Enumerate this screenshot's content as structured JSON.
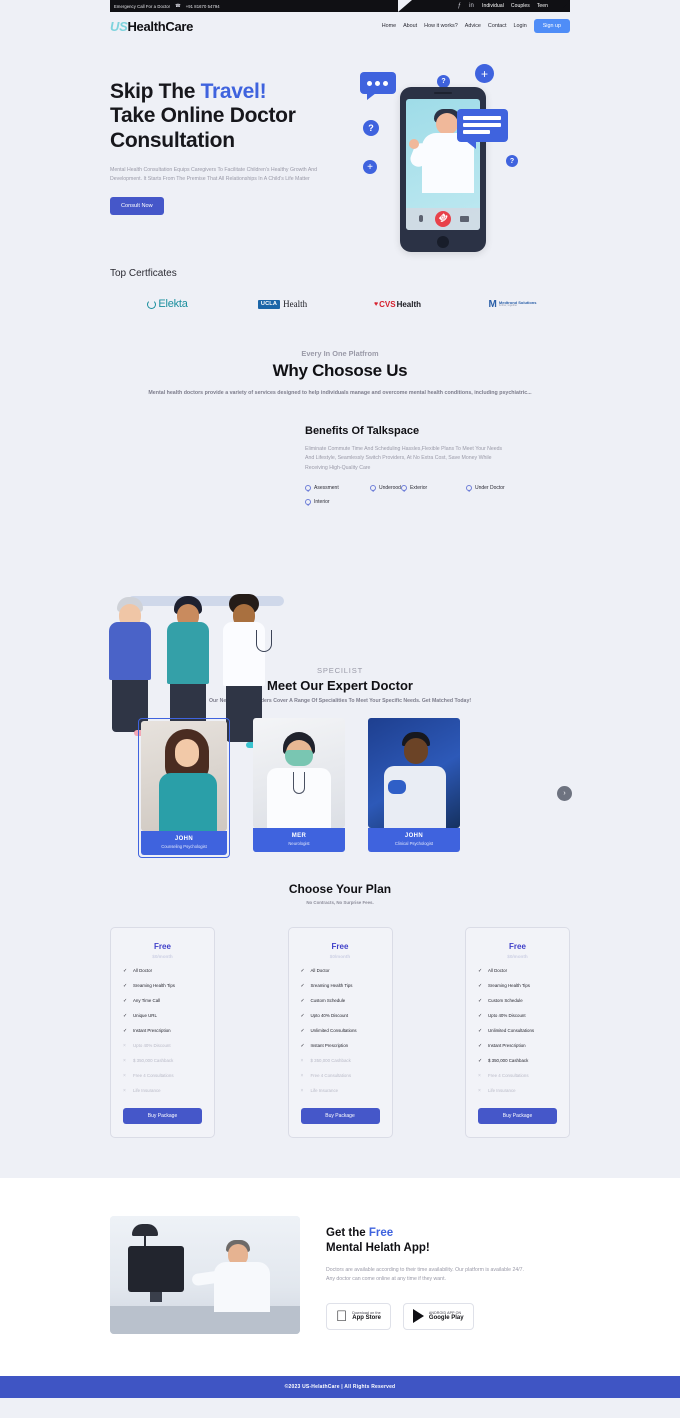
{
  "topbar": {
    "emergency_text": "Emergency Call For a Doctor",
    "phone_icon": "phone-icon",
    "phone": "+91 81670 54794",
    "social": [
      {
        "name": "facebook-icon",
        "glyph": "ƒ"
      },
      {
        "name": "linkedin-icon",
        "glyph": "in"
      }
    ],
    "links": [
      "Individual",
      "Couples",
      "Teen"
    ]
  },
  "nav": {
    "logo_us": "US",
    "logo_rest": "HealthCare",
    "links": [
      "Home",
      "About",
      "How it works?",
      "Advice",
      "Contact",
      "Login"
    ],
    "signup_label": "Sign up"
  },
  "hero": {
    "title_line1_a": "Skip The ",
    "title_line1_b": "Travel!",
    "title_line2": "Take Online Doctor",
    "title_line3": "Consultation",
    "paragraph": "Mental Health Consultation Equips Caregivers To Facilitate Children's Healthy Growth And Development. It Starts From The Premise That All Relationships In A Child's Life Matter",
    "cta_label": "Consult Now",
    "illustration": {
      "plus_glyph": "+",
      "question_glyph": "?"
    }
  },
  "certificates": {
    "title": "Top Certficates",
    "items": [
      {
        "name": "elekta-logo",
        "text": "Elekta"
      },
      {
        "name": "ucla-health-logo",
        "badge": "UCLA",
        "text": "Health"
      },
      {
        "name": "cvs-health-logo",
        "heart": "♥",
        "bold": "CVS",
        "text": "Health"
      },
      {
        "name": "medtronic-solutions-logo",
        "mark": "M",
        "text": "Medtrond Solutions",
        "sub": "further, together"
      }
    ]
  },
  "why": {
    "eyebrow": "Every In One Platfrom",
    "title": "Why Chosose Us",
    "subtitle": "Mental health doctors provide a variety of services designed to help individuals manage and overcome mental health conditions, including psychiatric..."
  },
  "benefits": {
    "title": "Benefits Of Talkspace",
    "paragraph": "Eliminate Commute Time And Scheduling Hassles,Flexible Plans To Meet Your Needs And Lifestyle, Seamlessly Switch Providers, At No Extra Cost, Save Money While Receiving High-Quality Care",
    "items": [
      "Asessment",
      "Underood",
      "Exterior",
      "Under Doctor",
      "Interior"
    ]
  },
  "specialist": {
    "eyebrow": "SPECILIST",
    "title": "Meet Our Expert Doctor",
    "subtitle": "Our Network of Providers Cover A Range Of Specialities To Meet Your Specific Needs. Get Matched Today!",
    "next_glyph": "›",
    "doctors": [
      {
        "name": "JOHN",
        "role": "Counseling Psychologist",
        "photo": "female-doctor-photo"
      },
      {
        "name": "MER",
        "role": "Neurologist",
        "photo": "masked-doctor-photo"
      },
      {
        "name": "JOHN",
        "role": "Clinical Psychologist",
        "photo": "lab-doctor-photo"
      }
    ]
  },
  "plans": {
    "title": "Choose Your Plan",
    "subtitle": "No Contracts, No Surprise Fees.",
    "buy_label": "Buy Package",
    "cards": [
      {
        "name": "Free",
        "price": "$0/month",
        "features": [
          {
            "label": "All Doctor",
            "included": true
          },
          {
            "label": "Sreaming Health Tips",
            "included": true
          },
          {
            "label": "Any Time Call",
            "included": true
          },
          {
            "label": "Unique URL",
            "included": true
          },
          {
            "label": "Instant Prescription",
            "included": true
          },
          {
            "label": "Upto 40% Discount",
            "included": false
          },
          {
            "label": "$ 350,000 Cashback",
            "included": false
          },
          {
            "label": "Free 4 Consultations",
            "included": false
          },
          {
            "label": "Life Insurance",
            "included": false
          }
        ]
      },
      {
        "name": "Free",
        "price": "$0/month",
        "features": [
          {
            "label": "All Doctor",
            "included": true
          },
          {
            "label": "Sreaming Health Tips",
            "included": true
          },
          {
            "label": "Custom Schedule",
            "included": true
          },
          {
            "label": "Upto 40% Discount",
            "included": true
          },
          {
            "label": "Unlimited Consultations",
            "included": true
          },
          {
            "label": "Instant Prescription",
            "included": true
          },
          {
            "label": "$ 350,000 Cashback",
            "included": false
          },
          {
            "label": "Free 4 Consultations",
            "included": false
          },
          {
            "label": "Life Insurance",
            "included": false
          }
        ]
      },
      {
        "name": "Free",
        "price": "$0/month",
        "features": [
          {
            "label": "All Doctor",
            "included": true
          },
          {
            "label": "Sreaming Health Tips",
            "included": true
          },
          {
            "label": "Custom Schedule",
            "included": true
          },
          {
            "label": "Upto 40% Discount",
            "included": true
          },
          {
            "label": "Unlimited Consultations",
            "included": true
          },
          {
            "label": "Instant Prescription",
            "included": true
          },
          {
            "label": "$ 350,000 Cashback",
            "included": true
          },
          {
            "label": "Free 4 Consultations",
            "included": false
          },
          {
            "label": "Life Insurance",
            "included": false
          }
        ]
      }
    ],
    "tick_included": "✓",
    "tick_excluded": "×"
  },
  "app": {
    "title_a": "Get the ",
    "title_b": "Free",
    "title_line2": "Mental Helath App!",
    "paragraph": "Doctors are available according to their time availability. Our platform is available 24/7. Any doctor can come online at any time if they want.",
    "stores": [
      {
        "name": "app-store-button",
        "small": "Download on the",
        "big": "App Store",
        "glyph": ""
      },
      {
        "name": "google-play-button",
        "small": "ANDROID APP ON",
        "big": "Google Play"
      }
    ]
  },
  "footer": {
    "text": "©2023 US-HelathCare | All Rights Reserved"
  },
  "colors": {
    "accent_blue": "#3f63de",
    "button_blue": "#4557c9",
    "signup_blue": "#4f8df7",
    "footer_blue": "#3f55c4",
    "page_bg": "#eef0f6",
    "logo_teal": "#7fd3dd"
  }
}
